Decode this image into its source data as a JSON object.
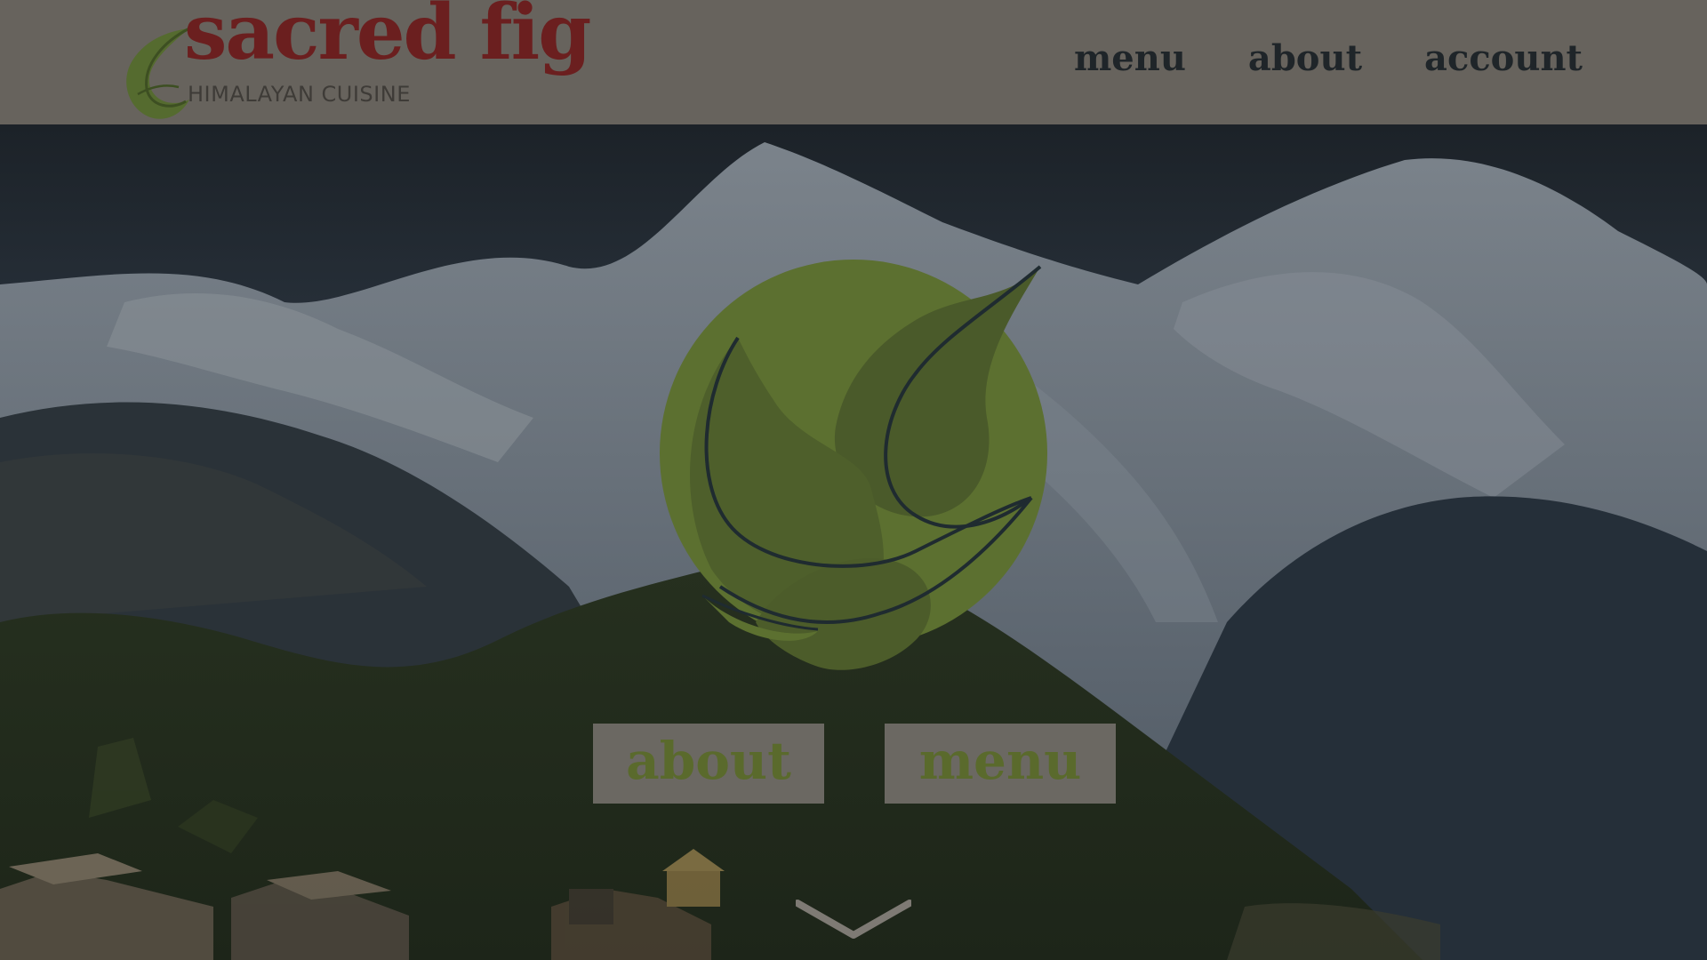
{
  "brand": {
    "name": "sacred fig",
    "subtitle": "HIMALAYAN CUISINE",
    "title_color": "#6b1f1f",
    "leaf_color": "#5f7a2e"
  },
  "nav": {
    "items": [
      {
        "label": "menu"
      },
      {
        "label": "about"
      },
      {
        "label": "account"
      }
    ]
  },
  "hero": {
    "buttons": [
      {
        "label": "about"
      },
      {
        "label": "menu"
      }
    ],
    "scroll_icon": "chevron-down-icon",
    "emblem_icon": "fig-leaf-icon"
  },
  "colors": {
    "header_bg": "#67635d",
    "nav_text": "#1f2529",
    "button_bg": "#6b6862",
    "button_text": "#5a6a2c"
  }
}
